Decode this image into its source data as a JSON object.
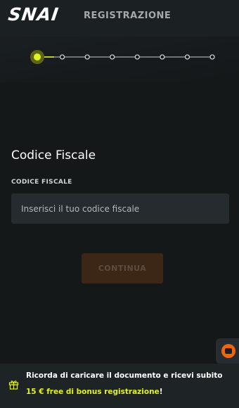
{
  "header": {
    "logo_text": "SNAI",
    "title": "REGISTRAZIONE"
  },
  "stepper": {
    "total_steps": 8,
    "current_step": 1
  },
  "form": {
    "section_title": "Codice Fiscale",
    "field_label": "CODICE FISCALE",
    "field_value": "",
    "field_placeholder": "Inserisci il tuo codice fiscale",
    "continue_label": "CONTINUA"
  },
  "chat": {
    "icon": "chat-icon"
  },
  "banner": {
    "icon": "gift-icon",
    "line1": "Ricorda di caricare il documento e ricevi subito",
    "line2_highlight": "15 € free di bonus registrazione",
    "line2_suffix": "!"
  },
  "colors": {
    "background": "#141819",
    "header": "#1b2022",
    "accent_yellow": "#e3f221",
    "button_disabled": "#3c2616",
    "chat_orange": "#f0660f"
  }
}
